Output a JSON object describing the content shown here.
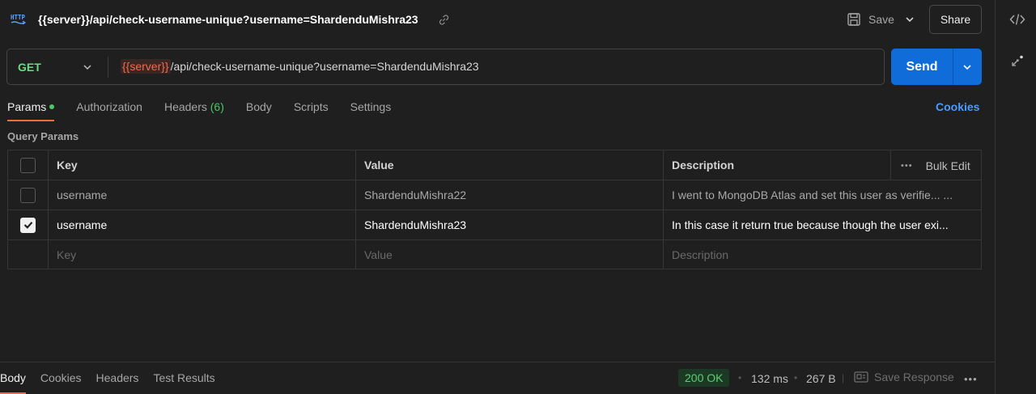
{
  "request": {
    "title": "{{server}}/api/check-username-unique?username=ShardenduMishra23",
    "method": "GET",
    "url_variable": "{{server}}",
    "url_rest": "/api/check-username-unique?username=ShardenduMishra23"
  },
  "toolbar": {
    "save_label": "Save",
    "share_label": "Share",
    "send_label": "Send"
  },
  "tabs": [
    {
      "label": "Params"
    },
    {
      "label": "Authorization"
    },
    {
      "label": "Headers",
      "count": "(6)"
    },
    {
      "label": "Body"
    },
    {
      "label": "Scripts"
    },
    {
      "label": "Settings"
    }
  ],
  "cookies_link": "Cookies",
  "query_params": {
    "section_label": "Query Params",
    "headers": {
      "key": "Key",
      "value": "Value",
      "description": "Description",
      "bulk_edit": "Bulk Edit"
    },
    "rows": [
      {
        "checked": false,
        "key": "username",
        "value": "ShardenduMishra22",
        "description": "I went to MongoDB Atlas and set this user as verifie... ..."
      },
      {
        "checked": true,
        "key": "username",
        "value": "ShardenduMishra23",
        "description": "In this case it return true because though the user exi..."
      }
    ],
    "placeholders": {
      "key": "Key",
      "value": "Value",
      "description": "Description"
    }
  },
  "response": {
    "tabs": [
      "Body",
      "Cookies",
      "Headers",
      "Test Results"
    ],
    "status": "200 OK",
    "time": "132 ms",
    "size": "267 B",
    "save_response": "Save Response"
  },
  "colors": {
    "accent": "#f26b3a",
    "send_blue": "#0f6cd8",
    "method_green": "#6bdd7e",
    "variable_red": "#f26b4e",
    "status_green": "#58d072"
  },
  "icons": [
    "http-icon",
    "link-icon",
    "save-icon",
    "chevron-down-icon",
    "code-icon",
    "sparkle-icon",
    "more-icon",
    "save-response-icon"
  ]
}
